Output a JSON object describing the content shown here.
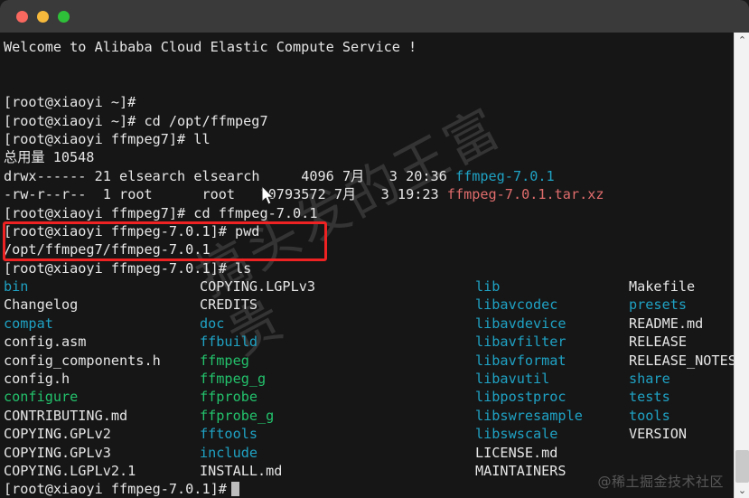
{
  "window": {
    "traffic_lights": [
      {
        "name": "close-button",
        "color": "#f9685f"
      },
      {
        "name": "minimize-button",
        "color": "#f6b93b"
      },
      {
        "name": "maximize-button",
        "color": "#2fc039"
      }
    ]
  },
  "terminal": {
    "welcome": "Welcome to Alibaba Cloud Elastic Compute Service !",
    "lines": [
      "[root@xiaoyi ~]#",
      "[root@xiaoyi ~]# cd /opt/ffmpeg7",
      "[root@xiaoyi ffmpeg7]# ll",
      "总用量 10548"
    ],
    "ll_rows": [
      {
        "perms": "drwx------",
        "links": "21",
        "owner": "elsearch",
        "group": "elsearch",
        "size": "4096",
        "month": "7月",
        "day": "3",
        "time": "20:36",
        "name": "ffmpeg-7.0.1",
        "name_color": "dir"
      },
      {
        "perms": "-rw-r--r--",
        "links": "1",
        "owner": "root",
        "group": "root",
        "size": "10793572",
        "month": "7月",
        "day": "3",
        "time": "19:23",
        "name": "ffmpeg-7.0.1.tar.xz",
        "name_color": "archive"
      }
    ],
    "cd_line": "[root@xiaoyi ffmpeg7]# cd ffmpeg-7.0.1",
    "pwd_cmd": "[root@xiaoyi ffmpeg-7.0.1]# pwd",
    "pwd_out": "/opt/ffmpeg7/ffmpeg-7.0.1",
    "ls_cmd": "[root@xiaoyi ffmpeg-7.0.1]# ls",
    "ls_grid": [
      [
        {
          "text": "bin",
          "color": "dir"
        },
        {
          "text": "COPYING.LGPLv3",
          "color": "plain"
        },
        {
          "text": "lib",
          "color": "dir"
        },
        {
          "text": "Makefile",
          "color": "plain"
        }
      ],
      [
        {
          "text": "Changelog",
          "color": "plain"
        },
        {
          "text": "CREDITS",
          "color": "plain"
        },
        {
          "text": "libavcodec",
          "color": "dir"
        },
        {
          "text": "presets",
          "color": "dir"
        }
      ],
      [
        {
          "text": "compat",
          "color": "dir"
        },
        {
          "text": "doc",
          "color": "dir"
        },
        {
          "text": "libavdevice",
          "color": "dir"
        },
        {
          "text": "README.md",
          "color": "plain"
        }
      ],
      [
        {
          "text": "config.asm",
          "color": "plain"
        },
        {
          "text": "ffbuild",
          "color": "dir"
        },
        {
          "text": "libavfilter",
          "color": "dir"
        },
        {
          "text": "RELEASE",
          "color": "plain"
        }
      ],
      [
        {
          "text": "config_components.h",
          "color": "plain"
        },
        {
          "text": "ffmpeg",
          "color": "exec"
        },
        {
          "text": "libavformat",
          "color": "dir"
        },
        {
          "text": "RELEASE_NOTES",
          "color": "plain"
        }
      ],
      [
        {
          "text": "config.h",
          "color": "plain"
        },
        {
          "text": "ffmpeg_g",
          "color": "exec"
        },
        {
          "text": "libavutil",
          "color": "dir"
        },
        {
          "text": "share",
          "color": "dir"
        }
      ],
      [
        {
          "text": "configure",
          "color": "exec"
        },
        {
          "text": "ffprobe",
          "color": "exec"
        },
        {
          "text": "libpostproc",
          "color": "dir"
        },
        {
          "text": "tests",
          "color": "dir"
        }
      ],
      [
        {
          "text": "CONTRIBUTING.md",
          "color": "plain"
        },
        {
          "text": "ffprobe_g",
          "color": "exec"
        },
        {
          "text": "libswresample",
          "color": "dir"
        },
        {
          "text": "tools",
          "color": "dir"
        }
      ],
      [
        {
          "text": "COPYING.GPLv2",
          "color": "plain"
        },
        {
          "text": "fftools",
          "color": "dir"
        },
        {
          "text": "libswscale",
          "color": "dir"
        },
        {
          "text": "VERSION",
          "color": "plain"
        }
      ],
      [
        {
          "text": "COPYING.GPLv3",
          "color": "plain"
        },
        {
          "text": "include",
          "color": "dir"
        },
        {
          "text": "LICENSE.md",
          "color": "plain"
        },
        {
          "text": "",
          "color": "plain"
        }
      ],
      [
        {
          "text": "COPYING.LGPLv2.1",
          "color": "plain"
        },
        {
          "text": "INSTALL.md",
          "color": "plain"
        },
        {
          "text": "MAINTAINERS",
          "color": "plain"
        },
        {
          "text": "",
          "color": "plain"
        }
      ]
    ],
    "final_prompt": "[root@xiaoyi ffmpeg-7.0.1]#"
  },
  "annotation": {
    "highlight_color": "#ee2222"
  },
  "watermarks": {
    "diagonal": "搞头发的王富贵",
    "corner": "@稀土掘金技术社区"
  },
  "scrollbar": {
    "up_arrow": "⌃",
    "down_arrow": "⌄"
  },
  "colors": {
    "background": "#161616",
    "titlebar": "#3a3a3a",
    "foreground": "#e6e6e6",
    "directory": "#1fa2c4",
    "executable": "#23c16b",
    "archive": "#e06c6c"
  }
}
